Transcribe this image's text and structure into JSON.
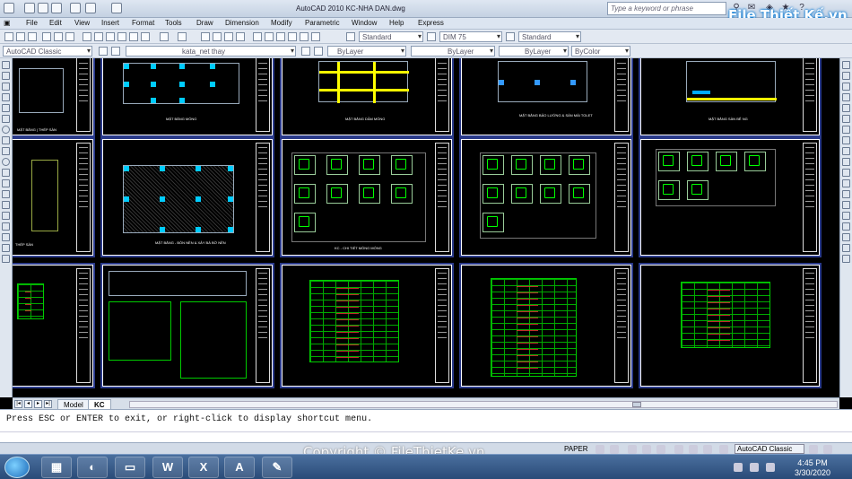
{
  "titlebar": {
    "title": "AutoCAD 2010    KC-NHA DAN.dwg",
    "search_placeholder": "Type a keyword or phrase",
    "logo": "File Thiết Kế.vn"
  },
  "menubar": [
    "File",
    "Edit",
    "View",
    "Insert",
    "Format",
    "Tools",
    "Draw",
    "Dimension",
    "Modify",
    "Parametric",
    "Window",
    "Help",
    "Express"
  ],
  "toolbar": {
    "text_style": "Standard",
    "dim_style": "DIM 75",
    "table_style": "Standard",
    "workspace": "AutoCAD Classic",
    "layer": "kata_net thay",
    "color": "ByLayer",
    "linetype": "ByLayer",
    "lineweight": "ByLayer",
    "plotstyle": "ByColor"
  },
  "sheets": {
    "s1": "MẶT BẰNG | THÉP SÀN",
    "s2": "MẶT BẰNG MÓNG",
    "s3": "MẶT BẰNG DẦM MÓNG",
    "s4": "MẶT BẰNG BẢO LƯỚNG & SÀN MÁI TOLET",
    "s5": "MẶT BẰNG SÀN BÊ NG",
    "s6": "THÉP SÀN",
    "s7": "MẶT BẰNG - BÓN NỀN & XÂY BÁ BỜ NỀN",
    "s8": "KC - CHI TIẾT MÓNG MÓNG"
  },
  "tabs": {
    "model": "Model",
    "layout": "KC"
  },
  "command": {
    "text": "Press ESC or ENTER to exit, or right-click to display shortcut menu."
  },
  "status": {
    "paper": "PAPER",
    "workspace": "AutoCAD Classic"
  },
  "watermark": "Copyright © FileThietKe.vn",
  "clock": {
    "time": "4:45 PM",
    "date": "3/30/2020"
  }
}
